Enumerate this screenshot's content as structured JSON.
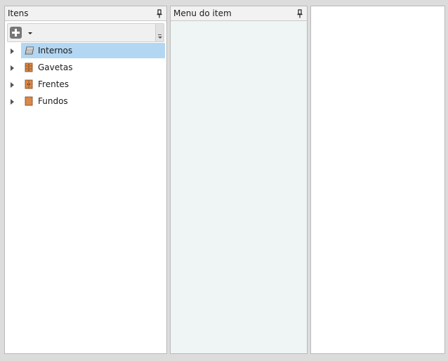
{
  "panes": {
    "itens": {
      "title": "Itens"
    },
    "menu": {
      "title": "Menu do item"
    }
  },
  "toolbar": {
    "add_icon": "plus-icon",
    "dropdown_icon": "caret-down-icon",
    "overflow_icon": "toolbar-overflow-icon"
  },
  "tree": {
    "items": [
      {
        "label": "Internos",
        "icon": "shelf-icon",
        "selected": true
      },
      {
        "label": "Gavetas",
        "icon": "drawer-icon",
        "selected": false
      },
      {
        "label": "Frentes",
        "icon": "door-icon",
        "selected": false
      },
      {
        "label": "Fundos",
        "icon": "back-panel-icon",
        "selected": false
      }
    ]
  },
  "colors": {
    "selection": "#b3d7f2",
    "menu_pane_bg": "#eff4f4",
    "wood": "#d9894a"
  }
}
